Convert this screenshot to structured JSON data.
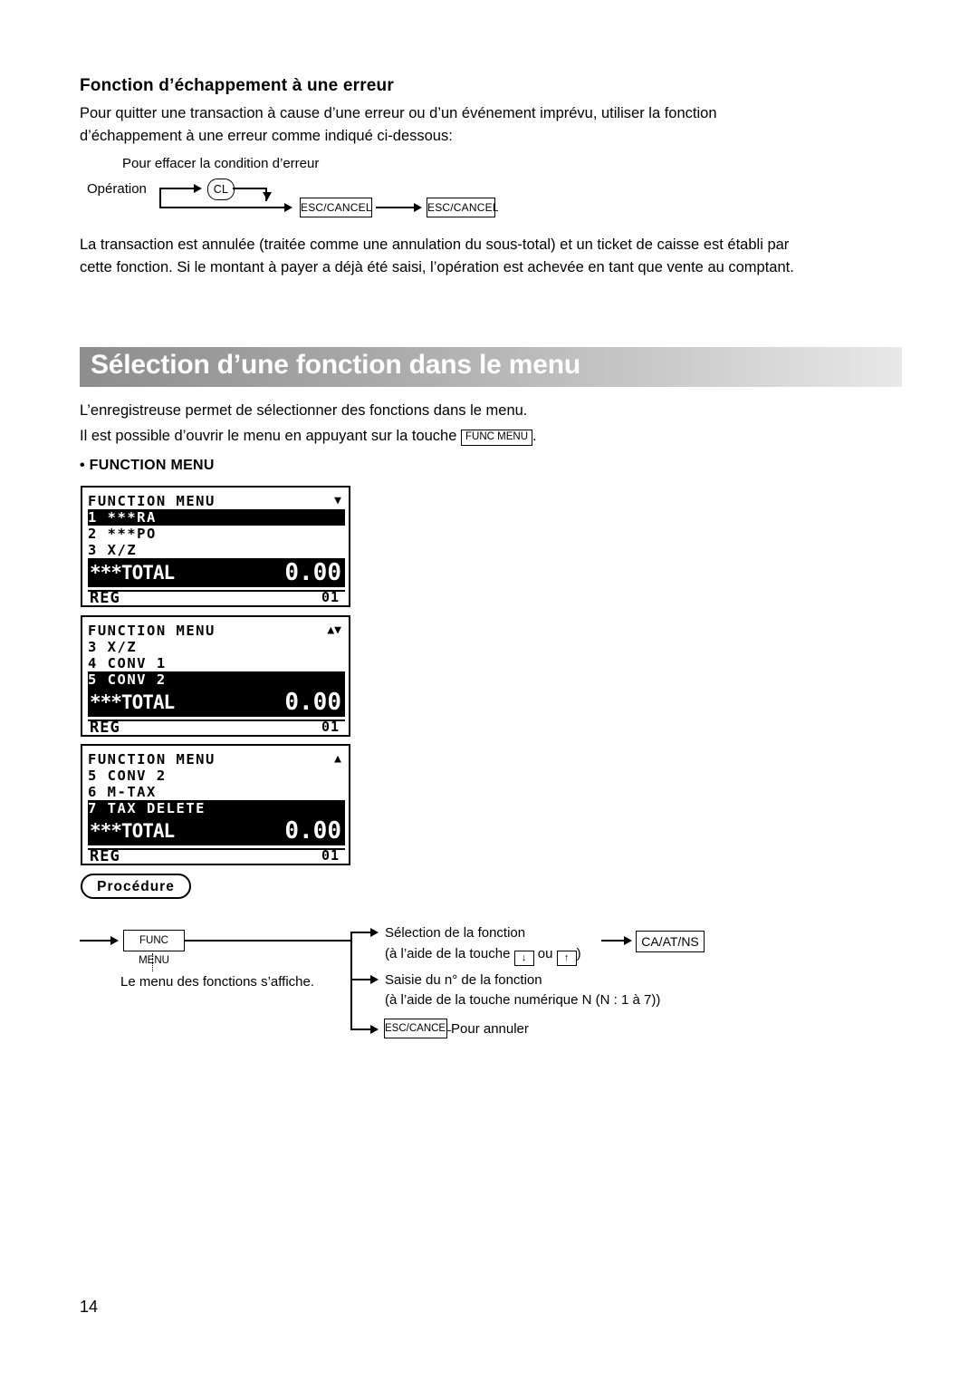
{
  "section1": {
    "title": "Fonction d’échappement à une erreur",
    "para1_line1": "Pour quitter une transaction à cause d’une erreur ou d’un événement imprévu, utiliser la fonction",
    "para1_line2": "d’échappement à une erreur comme indiqué ci-dessous:",
    "diagram": {
      "top_label": "Pour effacer la condition d’erreur",
      "operation_label": "Opération",
      "cl_key": "CL",
      "esc_key_1": "ESC/CANCEL",
      "esc_key_2": "ESC/CANCEL"
    },
    "para2_line1": "La transaction est annulée (traitée comme une annulation du sous-total) et un ticket de caisse est établi par",
    "para2_line2": "cette fonction. Si le montant à payer a déjà été saisi, l’opération est achevée en tant que vente au comptant."
  },
  "section2": {
    "banner_title": "Sélection d’une fonction dans le menu",
    "para1": "L’enregistreuse permet de sélectionner des fonctions dans le menu.",
    "para2_before": "Il est possible d’ouvrir le menu en appuyant sur la touche ",
    "para2_key": "FUNC MENU",
    "para2_after": ".",
    "bullet": "• FUNCTION MENU",
    "lcd_screens": [
      {
        "header": "FUNCTION MENU",
        "indicator": "▼",
        "rows": [
          {
            "text": "1 ***RA",
            "highlight": true
          },
          {
            "text": "2 ***PO",
            "highlight": false
          },
          {
            "text": "3 X/Z",
            "highlight": false
          }
        ],
        "total_label": "***TOTAL",
        "total_value": "0.00",
        "mode": "REG",
        "clerk": "01"
      },
      {
        "header": "FUNCTION MENU",
        "indicator": "▲▼",
        "rows": [
          {
            "text": "3 X/Z",
            "highlight": false
          },
          {
            "text": "4 CONV 1",
            "highlight": false
          },
          {
            "text": "5 CONV 2",
            "highlight": true
          }
        ],
        "total_label": "***TOTAL",
        "total_value": "0.00",
        "mode": "REG",
        "clerk": "01"
      },
      {
        "header": "FUNCTION MENU",
        "indicator": "▲",
        "rows": [
          {
            "text": "5 CONV 2",
            "highlight": false
          },
          {
            "text": "6 M-TAX",
            "highlight": false
          },
          {
            "text": "7 TAX DELETE",
            "highlight": true
          }
        ],
        "total_label": "***TOTAL",
        "total_value": "0.00",
        "mode": "REG",
        "clerk": "01"
      }
    ],
    "procedure": {
      "badge": "Procédure",
      "func_menu_key": "FUNC MENU",
      "menu_affiche": "Le menu des fonctions s’affiche.",
      "selection_line1": "Sélection de la fonction",
      "selection_line2_before": "(à l’aide de la touche ",
      "selection_key_down": "↓",
      "selection_line2_mid": " ou ",
      "selection_key_up": "↑",
      "selection_line2_after": ")",
      "saisie_line1": "Saisie du n° de la fonction",
      "saisie_line2": "(à l’aide de la touche numérique N (N : 1 à 7))",
      "ca_key": "CA/AT/NS",
      "esc_key": "ESC/CANCEL",
      "pour_annuler": "Pour annuler"
    }
  },
  "page_number": "14"
}
